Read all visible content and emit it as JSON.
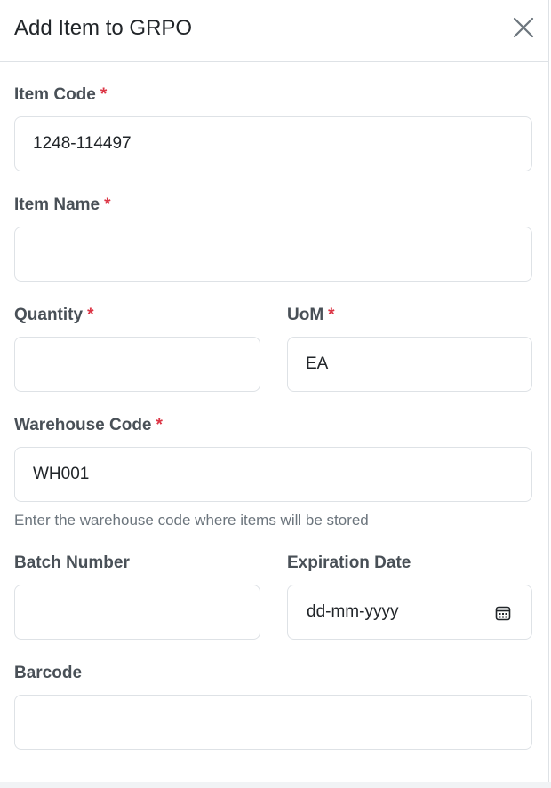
{
  "modal": {
    "title": "Add Item to GRPO",
    "close_icon": "close-icon"
  },
  "required_marker": "*",
  "fields": {
    "item_code": {
      "label": "Item Code",
      "required": true,
      "value": "1248-114497"
    },
    "item_name": {
      "label": "Item Name",
      "required": true,
      "value": ""
    },
    "quantity": {
      "label": "Quantity",
      "required": true,
      "value": ""
    },
    "uom": {
      "label": "UoM",
      "required": true,
      "value": "EA"
    },
    "warehouse_code": {
      "label": "Warehouse Code",
      "required": true,
      "value": "WH001",
      "help": "Enter the warehouse code where items will be stored"
    },
    "batch_number": {
      "label": "Batch Number",
      "required": false,
      "value": ""
    },
    "expiration_date": {
      "label": "Expiration Date",
      "required": false,
      "placeholder": "dd-mm-yyyy",
      "icon": "calendar-icon"
    },
    "barcode": {
      "label": "Barcode",
      "required": false,
      "value": ""
    }
  },
  "colors": {
    "required": "#dc3545",
    "label": "#495057",
    "border": "#dee2e6",
    "help": "#6c757d"
  }
}
